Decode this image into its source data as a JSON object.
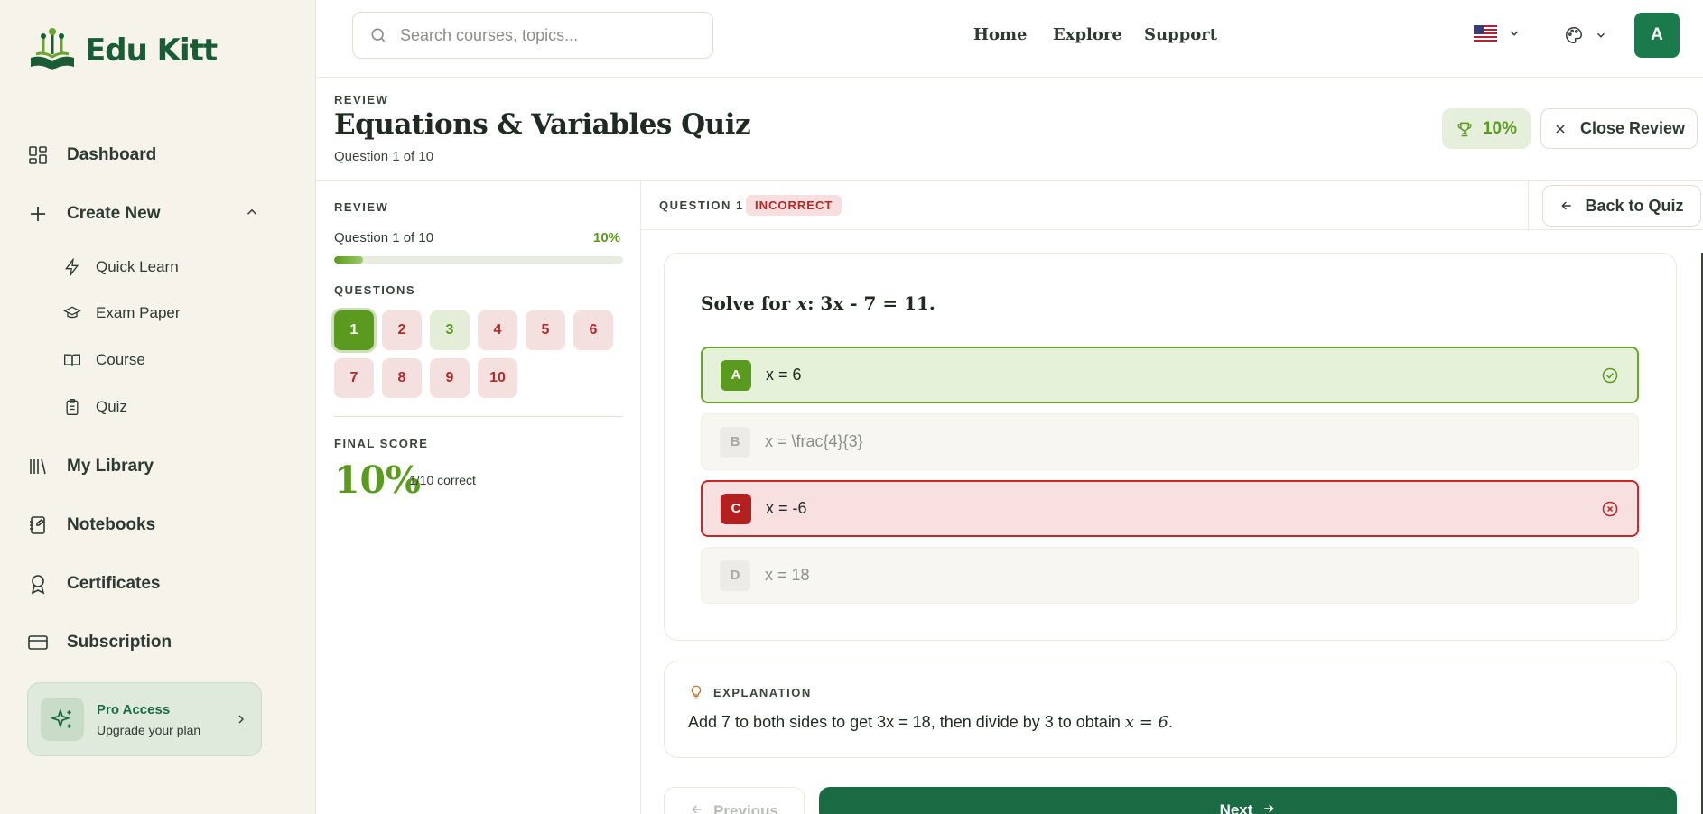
{
  "app": {
    "logo_text": "Edu Kitt",
    "brand_color": "#1a6b44",
    "accent_green": "#5a9a1f",
    "error_red": "#b42828"
  },
  "sidebar": {
    "items": [
      {
        "label": "Dashboard",
        "icon": "grid-icon"
      },
      {
        "label": "Create New",
        "icon": "plus-icon"
      },
      {
        "label": "My Library",
        "icon": "library-icon"
      },
      {
        "label": "Notebooks",
        "icon": "notebook-icon"
      },
      {
        "label": "Certificates",
        "icon": "award-icon"
      },
      {
        "label": "Subscription",
        "icon": "credit-card-icon"
      }
    ],
    "create_sub": [
      {
        "label": "Quick Learn",
        "icon": "lightning-icon"
      },
      {
        "label": "Exam Paper",
        "icon": "graduation-cap-icon"
      },
      {
        "label": "Course",
        "icon": "book-open-icon"
      },
      {
        "label": "Quiz",
        "icon": "clipboard-icon"
      }
    ],
    "pro": {
      "title": "Pro Access",
      "subtitle": "Upgrade your plan"
    }
  },
  "topbar": {
    "search_placeholder": "Search courses, topics...",
    "nav": [
      "Home",
      "Explore",
      "Support"
    ],
    "avatar_letter": "A"
  },
  "header": {
    "eyebrow": "REVIEW",
    "title": "Equations & Variables Quiz",
    "subtitle": "Question 1 of 10",
    "score": "10%",
    "close_label": "Close Review"
  },
  "review_panel": {
    "eyebrow": "REVIEW",
    "question_count": "Question 1 of 10",
    "percent": "10%",
    "progress_fraction": 0.1,
    "questions_label": "QUESTIONS",
    "questions": [
      {
        "n": "1",
        "state": "current"
      },
      {
        "n": "2",
        "state": "wrong"
      },
      {
        "n": "3",
        "state": "right"
      },
      {
        "n": "4",
        "state": "wrong"
      },
      {
        "n": "5",
        "state": "wrong"
      },
      {
        "n": "6",
        "state": "wrong"
      },
      {
        "n": "7",
        "state": "wrong"
      },
      {
        "n": "8",
        "state": "wrong"
      },
      {
        "n": "9",
        "state": "wrong"
      },
      {
        "n": "10",
        "state": "wrong"
      }
    ],
    "final_label": "FINAL SCORE",
    "final_score": "10%",
    "final_correct": "1/10 correct"
  },
  "question": {
    "label": "QUESTION 1",
    "status": "INCORRECT",
    "back_label": "Back to Quiz",
    "prefix": "Solve for ",
    "var": "x",
    "suffix": ": 3x - 7 = 11.",
    "options": [
      {
        "letter": "A",
        "text": "x = 6",
        "state": "correct"
      },
      {
        "letter": "B",
        "text": "x = \\frac{4}{3}",
        "state": "neutral"
      },
      {
        "letter": "C",
        "text": "x = -6",
        "state": "wrong"
      },
      {
        "letter": "D",
        "text": "x = 18",
        "state": "neutral"
      }
    ]
  },
  "explanation": {
    "label": "EXPLANATION",
    "text": "Add 7 to both sides to get 3x = 18, then divide by 3 to obtain ",
    "math": "x = 6",
    "end": "."
  },
  "footer": {
    "prev_label": "Previous",
    "next_label": "Next"
  }
}
